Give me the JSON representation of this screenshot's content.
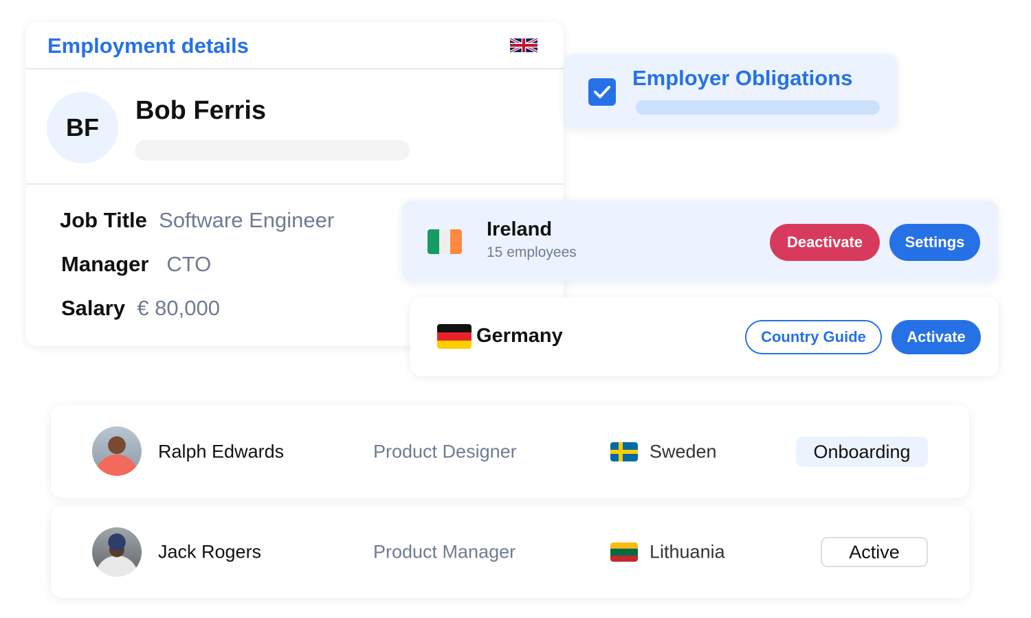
{
  "employment": {
    "title": "Employment details",
    "flag_icon": "uk-flag-icon",
    "initials": "BF",
    "name": "Bob Ferris",
    "fields": [
      {
        "label": "Job Title",
        "value": "Software Engineer"
      },
      {
        "label": "Manager",
        "value": "CTO"
      },
      {
        "label": "Salary",
        "value": "€ 80,000"
      }
    ]
  },
  "obligations": {
    "title": "Employer Obligations",
    "checked": true
  },
  "countries": [
    {
      "name": "Ireland",
      "subtitle": "15 employees",
      "buttons": [
        "Deactivate",
        "Settings"
      ]
    },
    {
      "name": "Germany",
      "buttons": [
        "Country Guide",
        "Activate"
      ]
    }
  ],
  "employees": [
    {
      "name": "Ralph Edwards",
      "role": "Product Designer",
      "country": "Sweden",
      "status": "Onboarding"
    },
    {
      "name": "Jack Rogers",
      "role": "Product Manager",
      "country": "Lithuania",
      "status": "Active"
    }
  ],
  "colors": {
    "blue": "#2671e6",
    "red": "#d83a5e",
    "light_blue": "#ecf3fe"
  }
}
